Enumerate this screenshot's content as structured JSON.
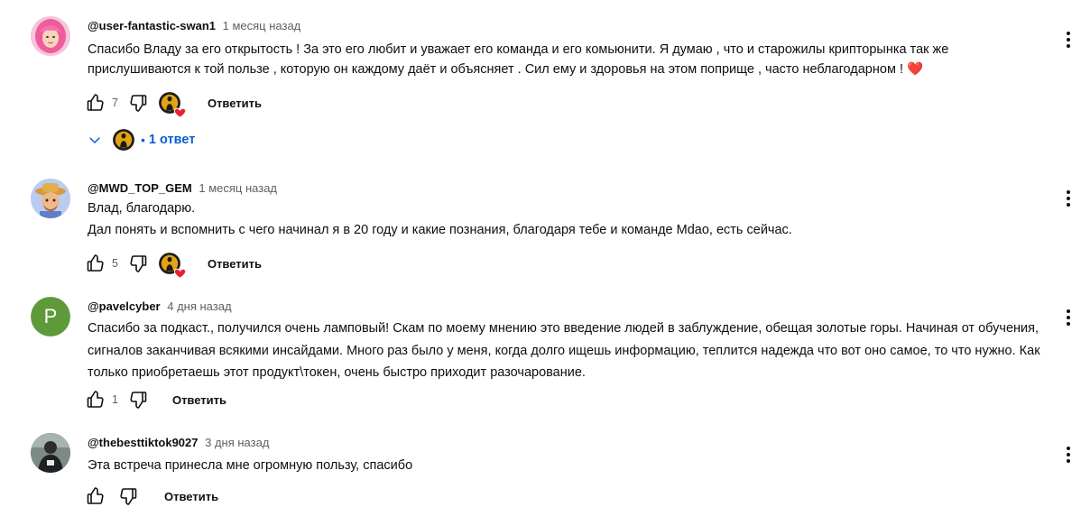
{
  "comments": [
    {
      "author": "@user-fantastic-swan1",
      "time": "1 месяц назад",
      "lines": [
        "Спасибо Владу за его открытость ! За это его  любит и уважает его команда и его комьюнити. Я думаю , что и  старожилы крипторынка так же прислушиваются к той пользе , которую он каждому даёт и объясняет . Сил ему и здоровья на этом поприще , часто неблагодарном ! ❤️"
      ],
      "likes": "7",
      "reply_label": "Ответить",
      "replies_label": "1 ответ",
      "replies_dot": "•",
      "avatar": "pink-hair-avatar"
    },
    {
      "author": "@MWD_TOP_GEM",
      "time": "1 месяц назад",
      "lines": [
        "Влад, благодарю.",
        "Дал понять и вспомнить с чего начинал я в 20 году и какие познания, благодаря тебе и команде Mdao, есть сейчас."
      ],
      "likes": "5",
      "reply_label": "Ответить",
      "avatar": "cartoon-farmer-avatar"
    },
    {
      "author": "@pavelcyber",
      "time": "4 дня назад",
      "lines": [
        "Спасибо за подкаст., получился очень ламповый! Скам по моему мнению это введение людей в заблуждение, обещая золотые горы. Начиная от обучения, сигналов заканчивая всякими инсайдами. Много раз было у меня, когда долго ищешь информацию, теплится надежда что вот оно самое, то что нужно. Как только приобретаешь этот продукт\\токен, очень быстро приходит разочарование."
      ],
      "likes": "1",
      "reply_label": "Ответить",
      "avatar_letter": "P",
      "avatar_color": "#5e9a3a"
    },
    {
      "author": "@thebesttiktok9027",
      "time": "3 дня назад",
      "lines": [
        "Эта встреча принесла мне огромную пользу, спасибо"
      ],
      "likes": "",
      "reply_label": "Ответить",
      "avatar": "photo-avatar"
    }
  ],
  "colors": {
    "link_blue": "#065fd4",
    "secondary_text": "#606060",
    "heart_red": "#e8232f",
    "creator_badge": "#e4a313"
  },
  "icons": [
    "like-icon",
    "dislike-icon",
    "creator-heart-icon",
    "more-vert-icon",
    "chevron-down-icon"
  ]
}
